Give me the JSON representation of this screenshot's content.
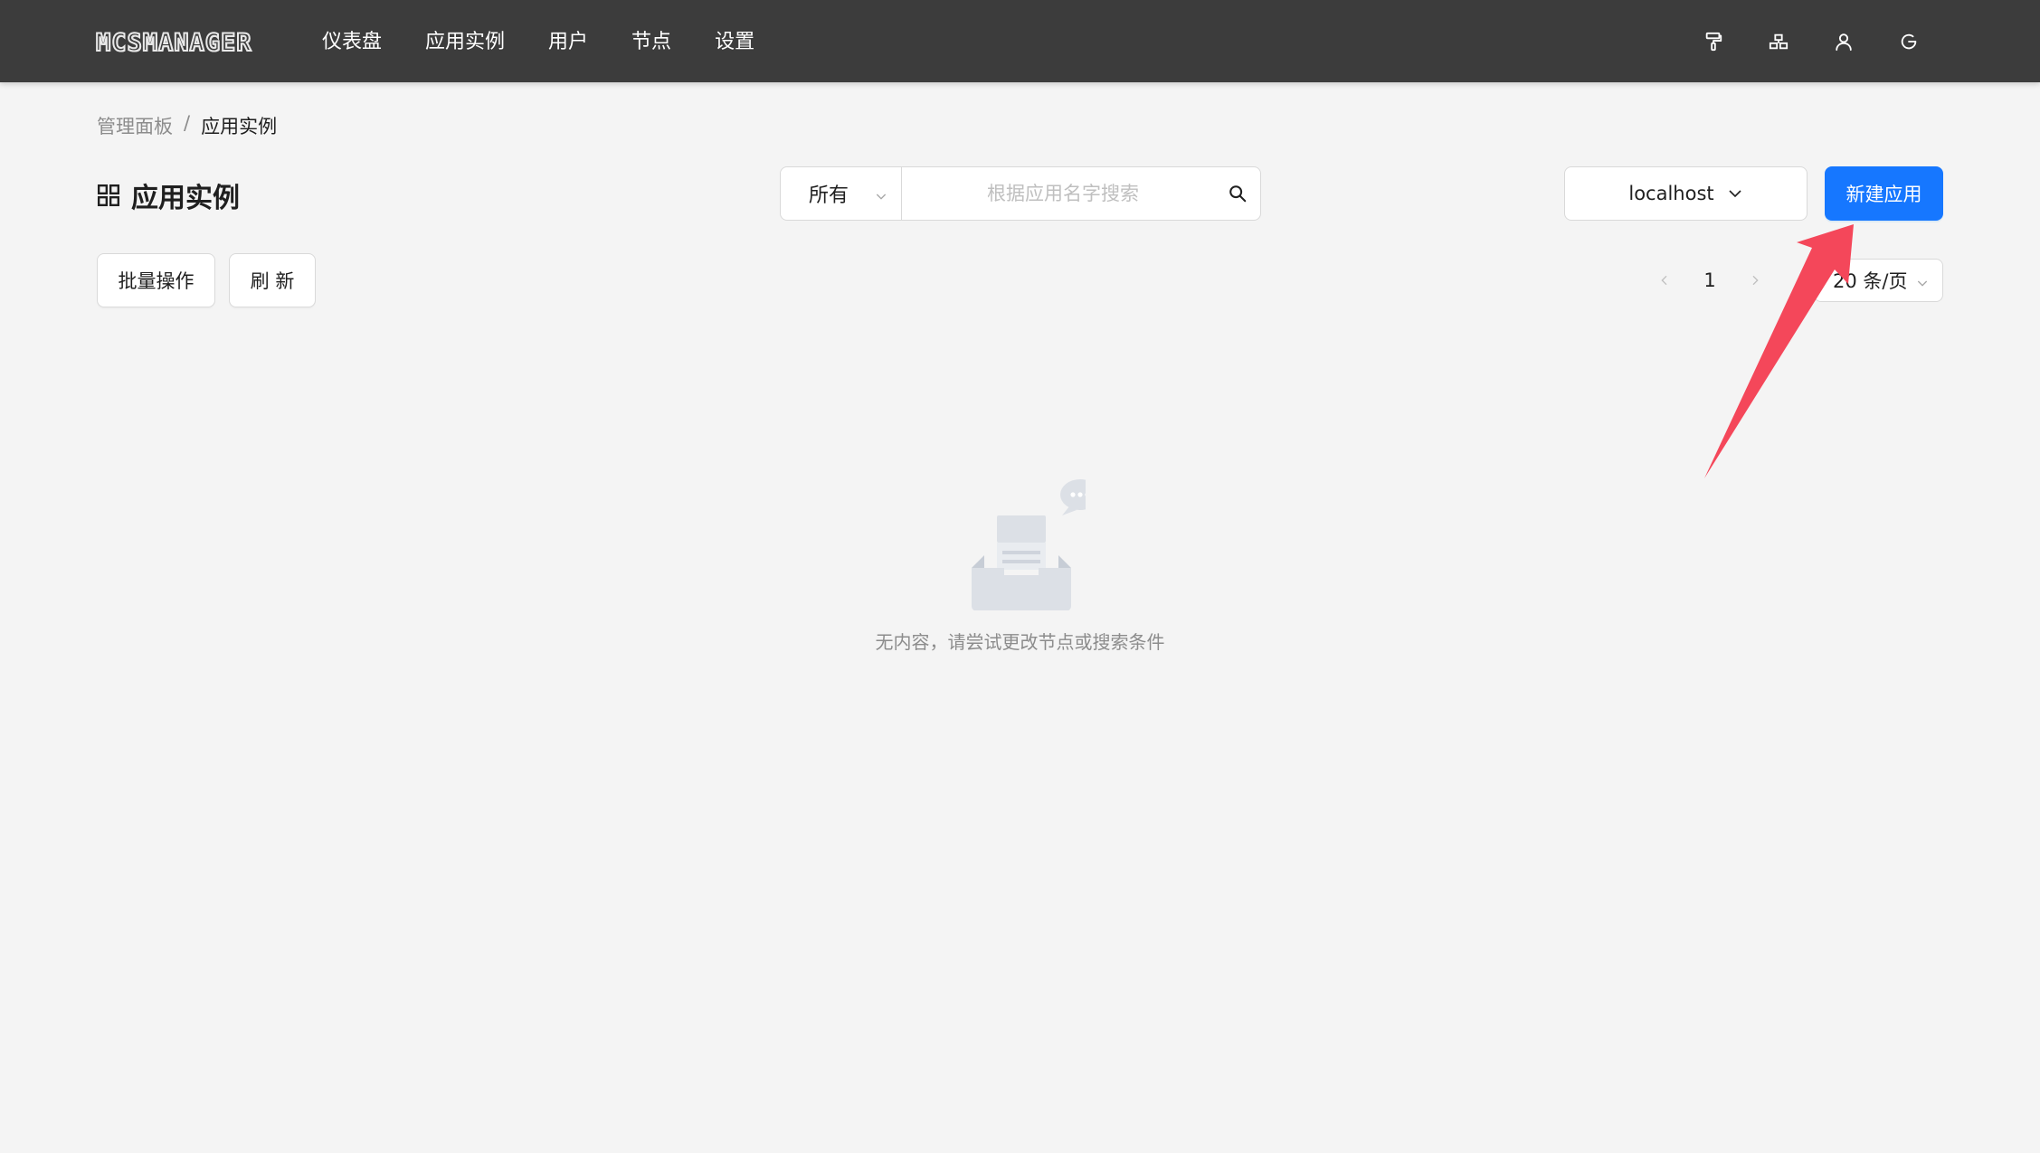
{
  "app": {
    "logo_text": "MCSMANAGER"
  },
  "nav": {
    "items": [
      {
        "label": "仪表盘"
      },
      {
        "label": "应用实例"
      },
      {
        "label": "用户"
      },
      {
        "label": "节点"
      },
      {
        "label": "设置"
      }
    ],
    "tools": [
      "paint-roller-icon",
      "network-icon",
      "user-icon",
      "refresh-icon"
    ]
  },
  "breadcrumb": {
    "parent": "管理面板",
    "separator": "/",
    "current": "应用实例"
  },
  "page": {
    "title": "应用实例",
    "title_icon": "grid-icon"
  },
  "filter": {
    "type_selected": "所有",
    "search_placeholder": "根据应用名字搜索",
    "search_value": ""
  },
  "node_select": {
    "selected": "localhost"
  },
  "actions": {
    "create_label": "新建应用",
    "batch_label": "批量操作",
    "refresh_label": "刷 新"
  },
  "pagination": {
    "current_page": "1",
    "page_size_label": "20 条/页"
  },
  "empty": {
    "text": "无内容，请尝试更改节点或搜索条件"
  },
  "colors": {
    "navbar_bg": "#3c3c3c",
    "page_bg": "#f4f4f4",
    "primary": "#1677ff",
    "annotation_arrow": "#f4475a"
  }
}
